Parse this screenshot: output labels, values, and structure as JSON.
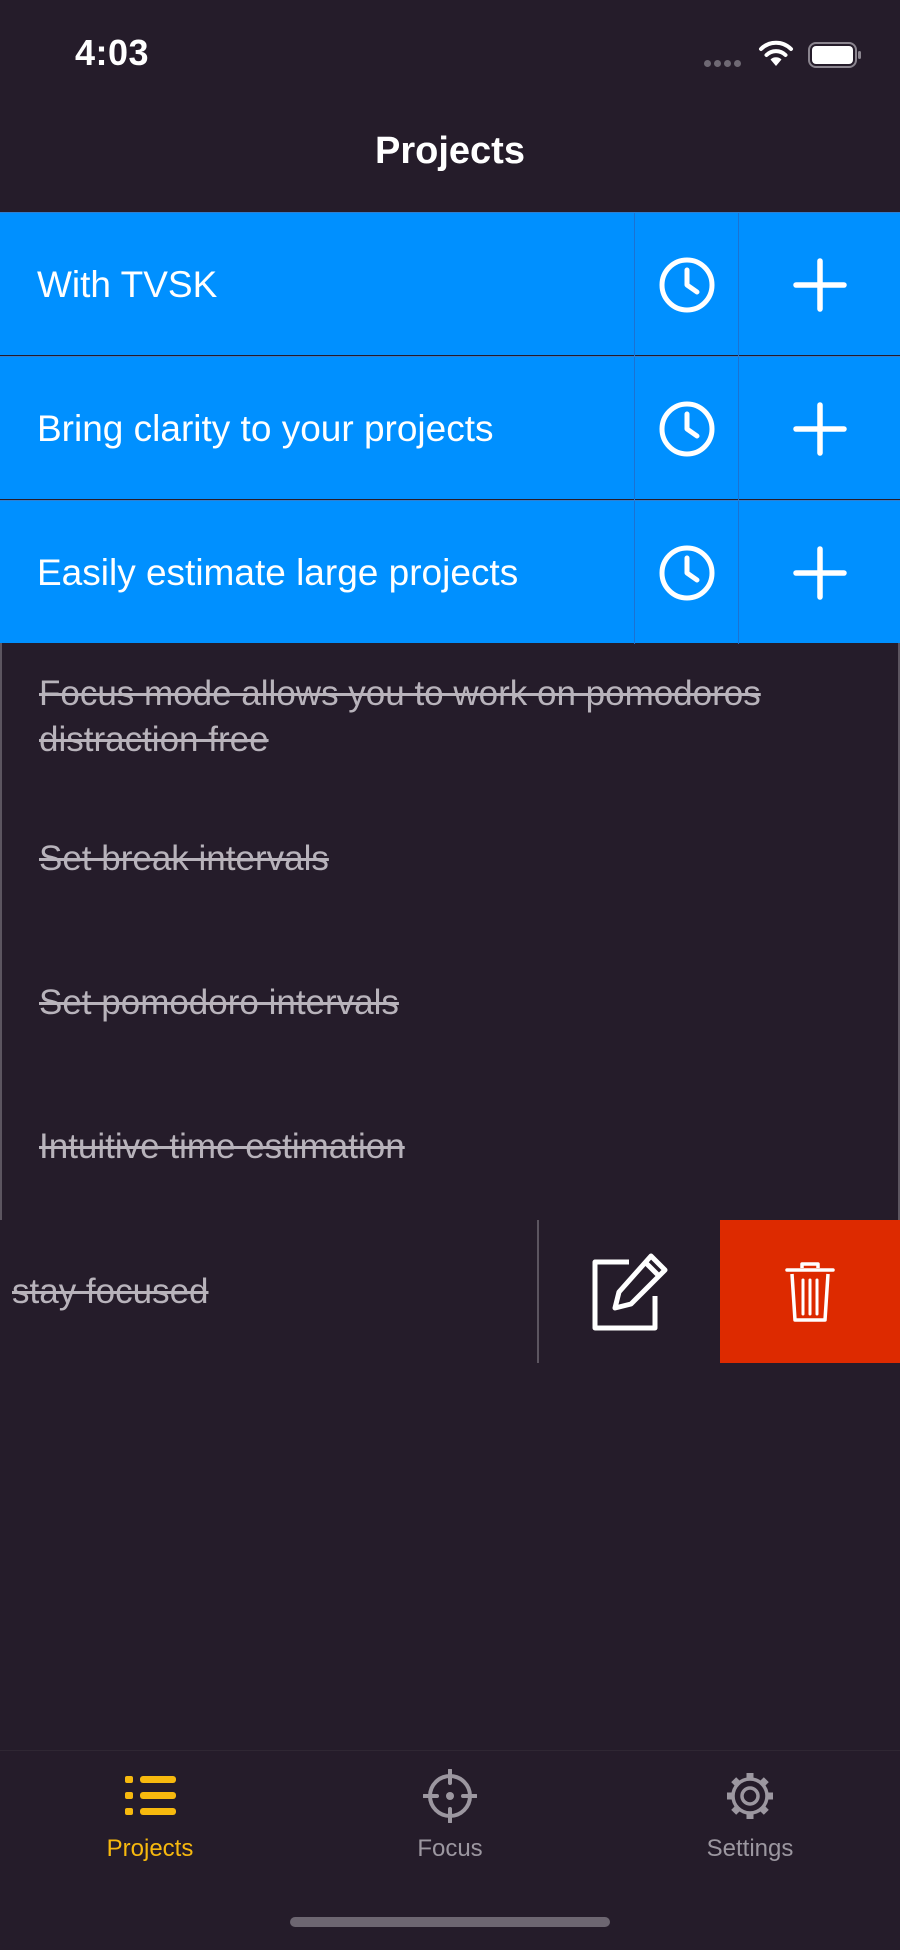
{
  "status_bar": {
    "time": "4:03"
  },
  "header": {
    "title": "Projects"
  },
  "projects": [
    {
      "title": "With TVSK"
    },
    {
      "title": "Bring clarity to your projects"
    },
    {
      "title": "Easily estimate large projects"
    }
  ],
  "tasks": [
    {
      "title": "Focus mode allows you to work on pomodoros distraction free",
      "completed": true
    },
    {
      "title": "Set break intervals",
      "completed": true
    },
    {
      "title": "Set pomodoro intervals",
      "completed": true
    },
    {
      "title": "Intuitive time estimation",
      "completed": true
    }
  ],
  "swiped_task": {
    "visible_text": "stay focused",
    "completed": true,
    "actions": [
      "edit",
      "delete"
    ]
  },
  "tab_bar": {
    "tabs": [
      {
        "label": "Projects",
        "icon": "list-icon",
        "active": true
      },
      {
        "label": "Focus",
        "icon": "crosshair-icon",
        "active": false
      },
      {
        "label": "Settings",
        "icon": "gear-icon",
        "active": false
      }
    ]
  },
  "colors": {
    "background": "#251c2a",
    "project_row": "#0090ff",
    "delete_action": "#dd2a00",
    "active_tab": "#f7b90e",
    "inactive_tab": "#9c97a0"
  }
}
